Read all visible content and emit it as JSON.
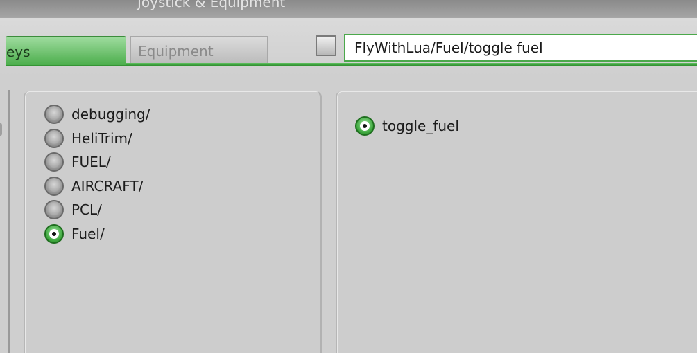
{
  "window": {
    "title": "Joystick & Equipment"
  },
  "tabs": {
    "active_label": "eys",
    "inactive_label": "Equipment"
  },
  "search": {
    "checkbox_checked": false,
    "value": "FlyWithLua/Fuel/toggle fuel"
  },
  "folders": {
    "items": [
      {
        "label": "debugging/",
        "selected": false
      },
      {
        "label": "HeliTrim/",
        "selected": false
      },
      {
        "label": "FUEL/",
        "selected": false
      },
      {
        "label": "AIRCRAFT/",
        "selected": false
      },
      {
        "label": "PCL/",
        "selected": false
      },
      {
        "label": "Fuel/",
        "selected": true
      }
    ]
  },
  "commands": {
    "items": [
      {
        "label": "toggle_fuel",
        "selected": true
      }
    ]
  },
  "colors": {
    "accent_green": "#4cae4c",
    "panel_gray": "#cdcdcd"
  }
}
